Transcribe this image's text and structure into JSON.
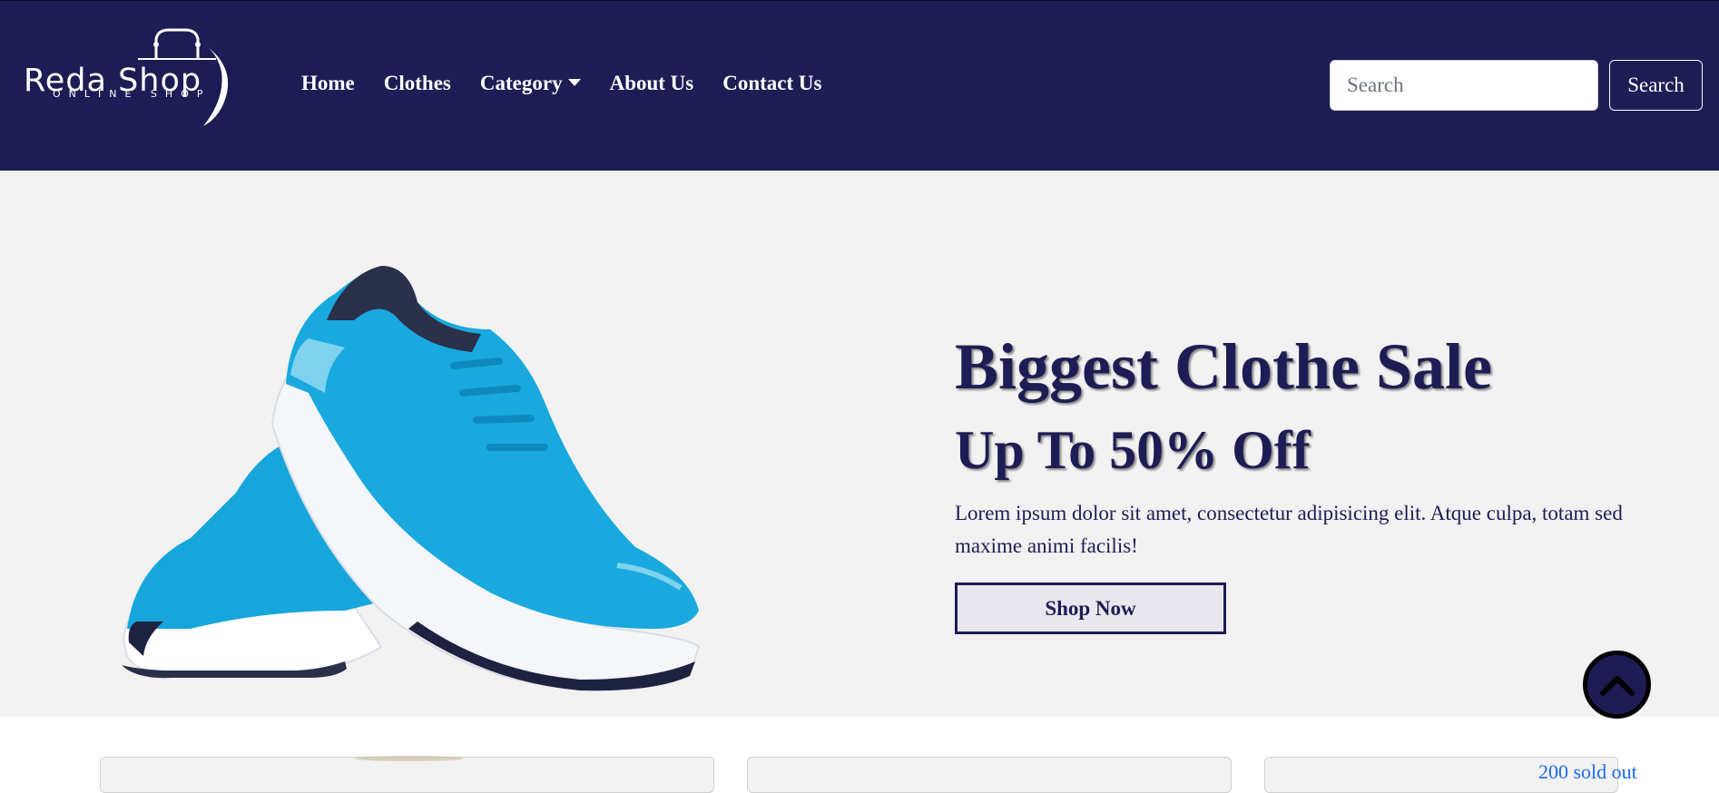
{
  "header": {
    "logo": {
      "title": "Reda Shop",
      "subtitle": "ONLINE SHOP"
    },
    "nav": [
      {
        "label": "Home"
      },
      {
        "label": "Clothes"
      },
      {
        "label": "Category",
        "has_dropdown": true
      },
      {
        "label": "About Us"
      },
      {
        "label": "Contact Us"
      }
    ],
    "search": {
      "placeholder": "Search",
      "value": "",
      "button_label": "Search"
    }
  },
  "hero": {
    "title": "Biggest Clothe Sale",
    "subtitle": "Up To 50% Off",
    "description": "Lorem ipsum dolor sit amet, consectetur adipisicing elit. Atque culpa, totam sed maxime animi facilis!",
    "button_label": "Shop Now",
    "image": "blue-running-shoes"
  },
  "scroll_top": {
    "icon": "chevron-up-icon"
  },
  "cards": {
    "partial_link_text": "200 sold out"
  },
  "colors": {
    "brand": "#1e1c54",
    "hero_bg": "#f2f2f2",
    "link": "#1a6bf0"
  }
}
